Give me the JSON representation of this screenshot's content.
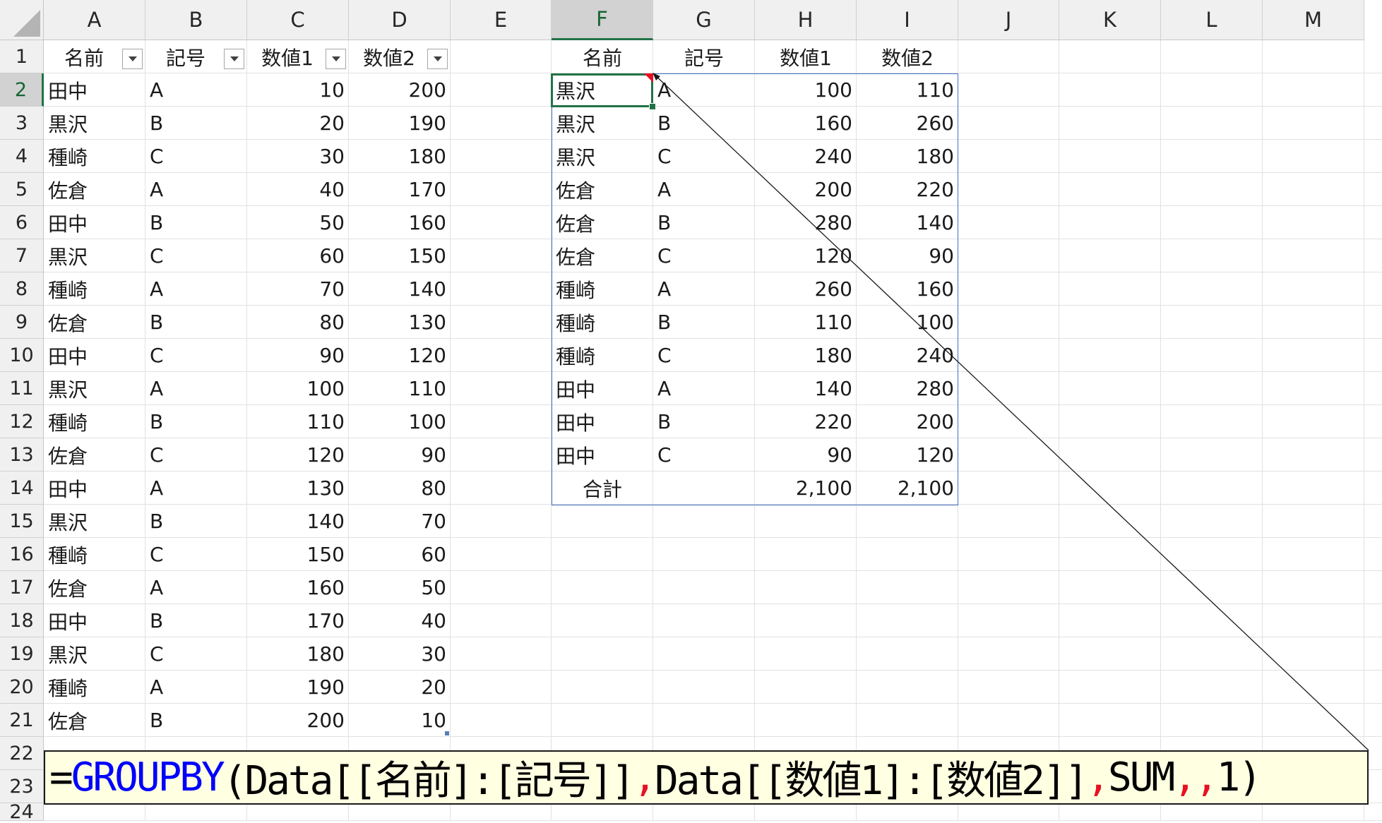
{
  "columns": [
    "A",
    "B",
    "C",
    "D",
    "E",
    "F",
    "G",
    "H",
    "I",
    "J",
    "K",
    "L",
    "M"
  ],
  "selected_column": "F",
  "rows": [
    "1",
    "2",
    "3",
    "4",
    "5",
    "6",
    "7",
    "8",
    "9",
    "10",
    "11",
    "12",
    "13",
    "14",
    "15",
    "16",
    "17",
    "18",
    "19",
    "20",
    "21",
    "22",
    "23",
    "24"
  ],
  "selected_row": "2",
  "source_table": {
    "headers": [
      "名前",
      "記号",
      "数値1",
      "数値2"
    ],
    "rows": [
      [
        "田中",
        "A",
        "10",
        "200"
      ],
      [
        "黒沢",
        "B",
        "20",
        "190"
      ],
      [
        "種崎",
        "C",
        "30",
        "180"
      ],
      [
        "佐倉",
        "A",
        "40",
        "170"
      ],
      [
        "田中",
        "B",
        "50",
        "160"
      ],
      [
        "黒沢",
        "C",
        "60",
        "150"
      ],
      [
        "種崎",
        "A",
        "70",
        "140"
      ],
      [
        "佐倉",
        "B",
        "80",
        "130"
      ],
      [
        "田中",
        "C",
        "90",
        "120"
      ],
      [
        "黒沢",
        "A",
        "100",
        "110"
      ],
      [
        "種崎",
        "B",
        "110",
        "100"
      ],
      [
        "佐倉",
        "C",
        "120",
        "90"
      ],
      [
        "田中",
        "A",
        "130",
        "80"
      ],
      [
        "黒沢",
        "B",
        "140",
        "70"
      ],
      [
        "種崎",
        "C",
        "150",
        "60"
      ],
      [
        "佐倉",
        "A",
        "160",
        "50"
      ],
      [
        "田中",
        "B",
        "170",
        "40"
      ],
      [
        "黒沢",
        "C",
        "180",
        "30"
      ],
      [
        "種崎",
        "A",
        "190",
        "20"
      ],
      [
        "佐倉",
        "B",
        "200",
        "10"
      ]
    ]
  },
  "result_table": {
    "headers": [
      "名前",
      "記号",
      "数値1",
      "数値2"
    ],
    "rows": [
      [
        "黒沢",
        "A",
        "100",
        "110"
      ],
      [
        "黒沢",
        "B",
        "160",
        "260"
      ],
      [
        "黒沢",
        "C",
        "240",
        "180"
      ],
      [
        "佐倉",
        "A",
        "200",
        "220"
      ],
      [
        "佐倉",
        "B",
        "280",
        "140"
      ],
      [
        "佐倉",
        "C",
        "120",
        "90"
      ],
      [
        "種崎",
        "A",
        "260",
        "160"
      ],
      [
        "種崎",
        "B",
        "110",
        "100"
      ],
      [
        "種崎",
        "C",
        "180",
        "240"
      ],
      [
        "田中",
        "A",
        "140",
        "280"
      ],
      [
        "田中",
        "B",
        "220",
        "200"
      ],
      [
        "田中",
        "C",
        "90",
        "120"
      ]
    ],
    "total_label": "合計",
    "total_values": [
      "2,100",
      "2,100"
    ]
  },
  "formula": {
    "parts": [
      {
        "text": "=",
        "color": "#000000"
      },
      {
        "text": "GROUPBY",
        "color": "#0000ff"
      },
      {
        "text": "(Data[[名前]:[記号]]",
        "color": "#000000"
      },
      {
        "text": ",",
        "color": "#e81123"
      },
      {
        "text": "Data[[数値1]:[数値2]]",
        "color": "#000000"
      },
      {
        "text": ",",
        "color": "#e81123"
      },
      {
        "text": "SUM",
        "color": "#000000"
      },
      {
        "text": ",,",
        "color": "#e81123"
      },
      {
        "text": "1)",
        "color": "#000000"
      }
    ]
  },
  "colors": {
    "selection_green": "#217346",
    "spill_border_blue": "#4472c4",
    "comment_red": "#e81123",
    "formula_background": "#ffffe1"
  }
}
